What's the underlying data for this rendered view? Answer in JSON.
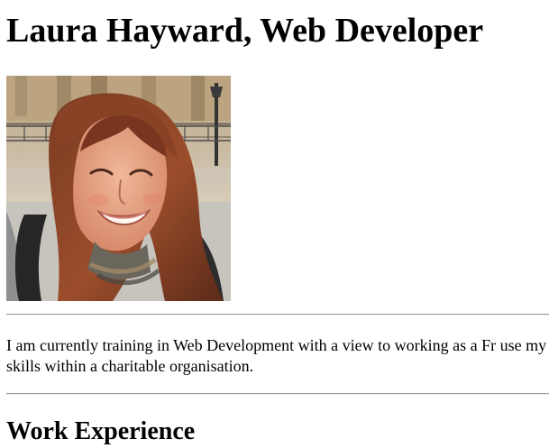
{
  "header": {
    "title": "Laura Hayward, Web Developer"
  },
  "profile_photo": {
    "icon": "portrait-photo"
  },
  "intro": {
    "text": "I am currently training in Web Development with a view to working as a Fr use my skills within a charitable organisation."
  },
  "sections": {
    "work_experience_title": "Work Experience"
  },
  "colors": {
    "text": "#000000",
    "background": "#ffffff",
    "rule": "#9a9a9a"
  }
}
